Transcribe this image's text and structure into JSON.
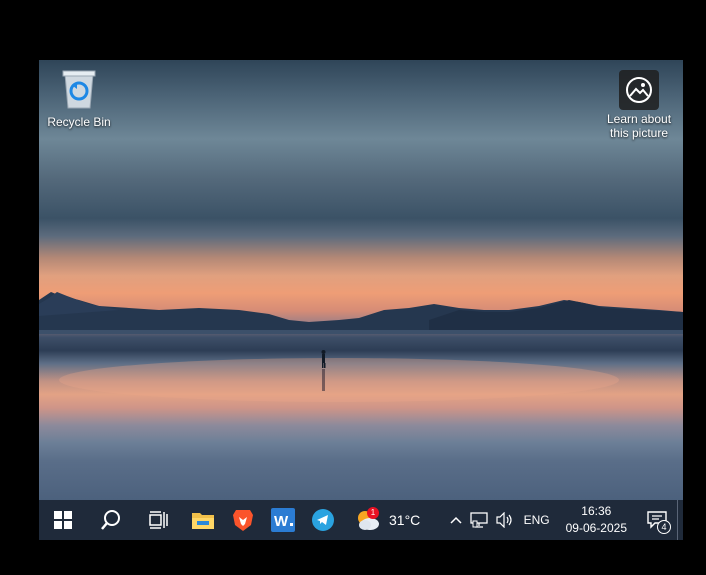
{
  "desktop": {
    "icons": [
      {
        "label": "Recycle Bin",
        "icon": "recycle-bin-icon"
      },
      {
        "label": "Learn about this picture",
        "icon": "camera-pin-icon"
      }
    ]
  },
  "taskbar": {
    "apps": [
      {
        "name": "start",
        "icon": "windows-logo-icon"
      },
      {
        "name": "search",
        "icon": "search-icon"
      },
      {
        "name": "task-view",
        "icon": "task-view-icon"
      },
      {
        "name": "file-explorer",
        "icon": "folder-icon"
      },
      {
        "name": "brave",
        "icon": "brave-lion-icon"
      },
      {
        "name": "word",
        "icon": "word-icon"
      },
      {
        "name": "telegram",
        "icon": "telegram-icon"
      }
    ],
    "weather": {
      "temp": "31°C",
      "badge": "1"
    },
    "tray": {
      "language": "ENG",
      "time": "16:36",
      "date": "09-06-2025",
      "notification_count": "4"
    }
  },
  "colors": {
    "taskbar_bg": "#1f2a3a",
    "accent_blue": "#1e88e5",
    "brave_orange": "#fb542b",
    "telegram_blue": "#2aa3e0",
    "word_blue": "#2b7cd3"
  }
}
